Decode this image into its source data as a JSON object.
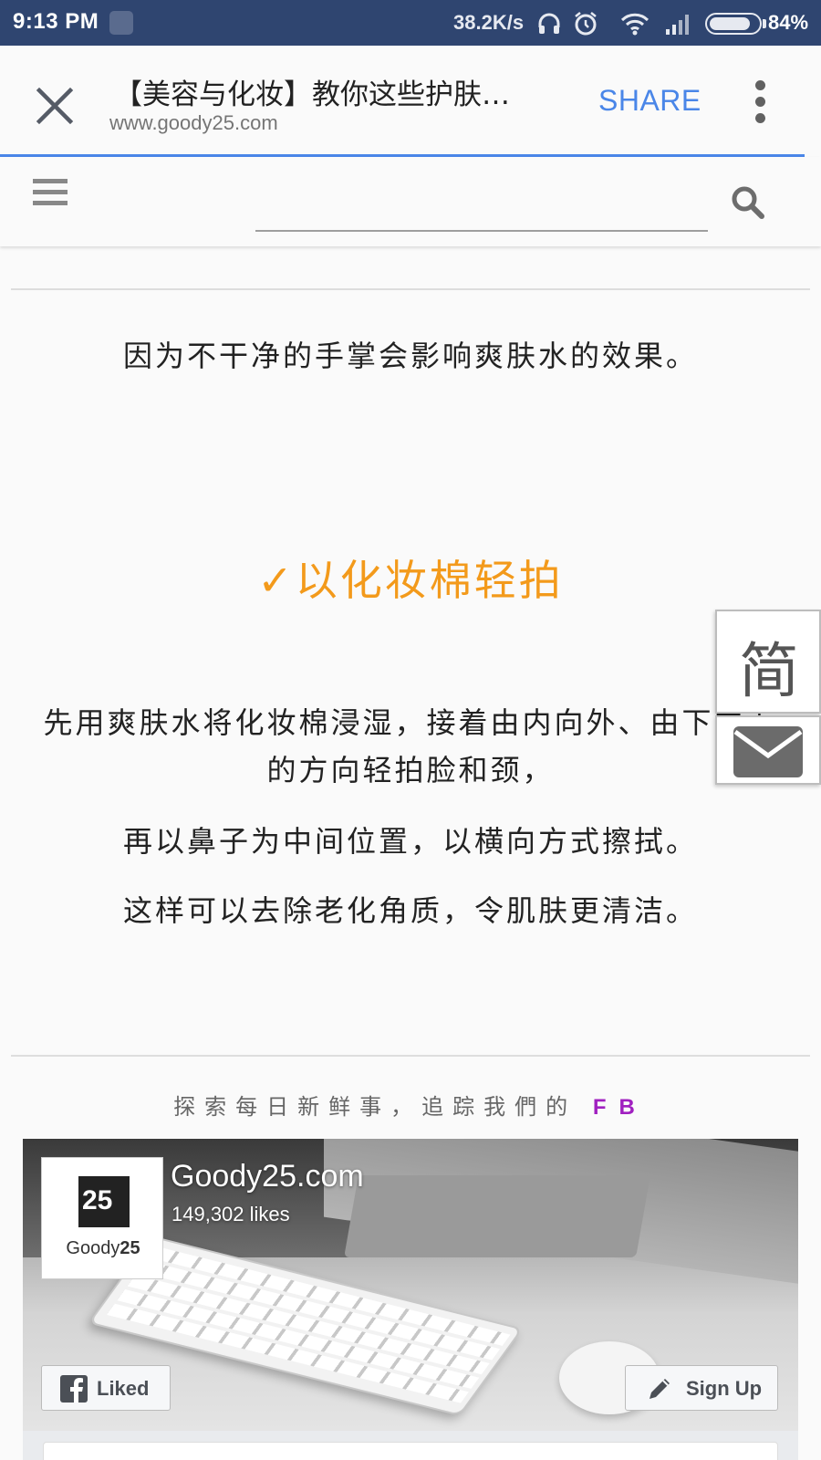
{
  "status_bar": {
    "time": "9:13 PM",
    "net_speed": "38.2K/s",
    "battery_pct": "84%",
    "battery_level": 0.84,
    "icons": [
      "screenshot-icon",
      "headphones-icon",
      "alarm-icon",
      "wifi-icon",
      "signal-icon",
      "battery-icon"
    ]
  },
  "toolbar": {
    "title": "【美容与化妆】教你这些护肤…",
    "url": "www.goody25.com",
    "share_label": "SHARE",
    "accent": "#4a86e8"
  },
  "site_header": {
    "menu_icon": "hamburger-icon",
    "search_icon": "search-icon"
  },
  "article": {
    "para1": "因为不干净的手掌会影响爽肤水的效果。",
    "heading_check": "✓",
    "heading": "以化妆棉轻拍",
    "heading_color": "#f39a1b",
    "para2_line1": "先用爽肤水将化妆棉浸湿，接着由内向外、由下向上",
    "para2_line2": "的方向轻拍脸和颈，",
    "para3": "再以鼻子为中间位置，以横向方式擦拭。",
    "para4": "这样可以去除老化角质，令肌肤更清洁。"
  },
  "side_buttons": {
    "simplified": "简",
    "mail_icon": "mail-icon"
  },
  "follow": {
    "text": "探索每日新鲜事，追踪我們的",
    "fb": "FB"
  },
  "fb_widget": {
    "page_name": "Goody25.com",
    "likes": "149,302 likes",
    "logo_mark": "25",
    "logo_word_a": "Goody",
    "logo_word_b": "25",
    "liked_label": "Liked",
    "signup_label": "Sign Up"
  }
}
